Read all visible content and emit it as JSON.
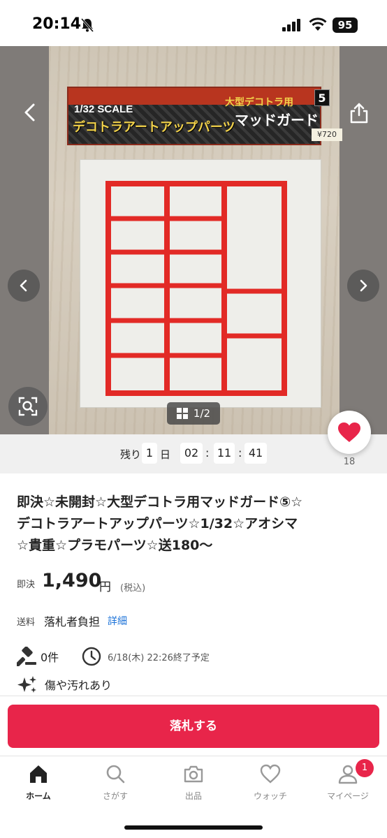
{
  "status_bar": {
    "time": "20:14",
    "battery": "95"
  },
  "gallery": {
    "package": {
      "scale": "1/32 SCALE",
      "series": "デコトラアートアップパーツ",
      "subtitle": "大型デコトラ用",
      "name": "マッドガード",
      "number": "5",
      "price_tag": "¥720"
    },
    "page_current": "1",
    "page_separator": "/",
    "page_total": "2"
  },
  "countdown": {
    "remaining_label": "残り",
    "days": "1",
    "day_unit": "日",
    "hours": "02",
    "minutes": "11",
    "seconds": "41",
    "separator": ":"
  },
  "like": {
    "count": "18"
  },
  "item": {
    "title_line1": "即決☆未開封☆大型デコトラ用マッドガード⑤☆",
    "title_line2": "デコトラアートアップパーツ☆1/32☆アオシマ",
    "title_line3": "☆貴重☆プラモパーツ☆送180〜",
    "price_label": "即決",
    "price_value": "1,490",
    "price_unit": "円",
    "tax_note": "(税込)",
    "shipping_label": "送料",
    "shipping_value": "落札者負担",
    "shipping_detail_link": "詳細",
    "bid_count": "0件",
    "end_time": "6/18(木) 22:26終了予定",
    "condition": "傷や汚れあり"
  },
  "bid_button_label": "落札する",
  "tabs": [
    {
      "label": "ホーム",
      "icon": "home-icon"
    },
    {
      "label": "さがす",
      "icon": "search-icon"
    },
    {
      "label": "出品",
      "icon": "camera-icon"
    },
    {
      "label": "ウォッチ",
      "icon": "heart-icon"
    },
    {
      "label": "マイページ",
      "icon": "user-icon",
      "badge": "1"
    }
  ],
  "colors": {
    "accent": "#e8254a",
    "link": "#1b72d8"
  }
}
